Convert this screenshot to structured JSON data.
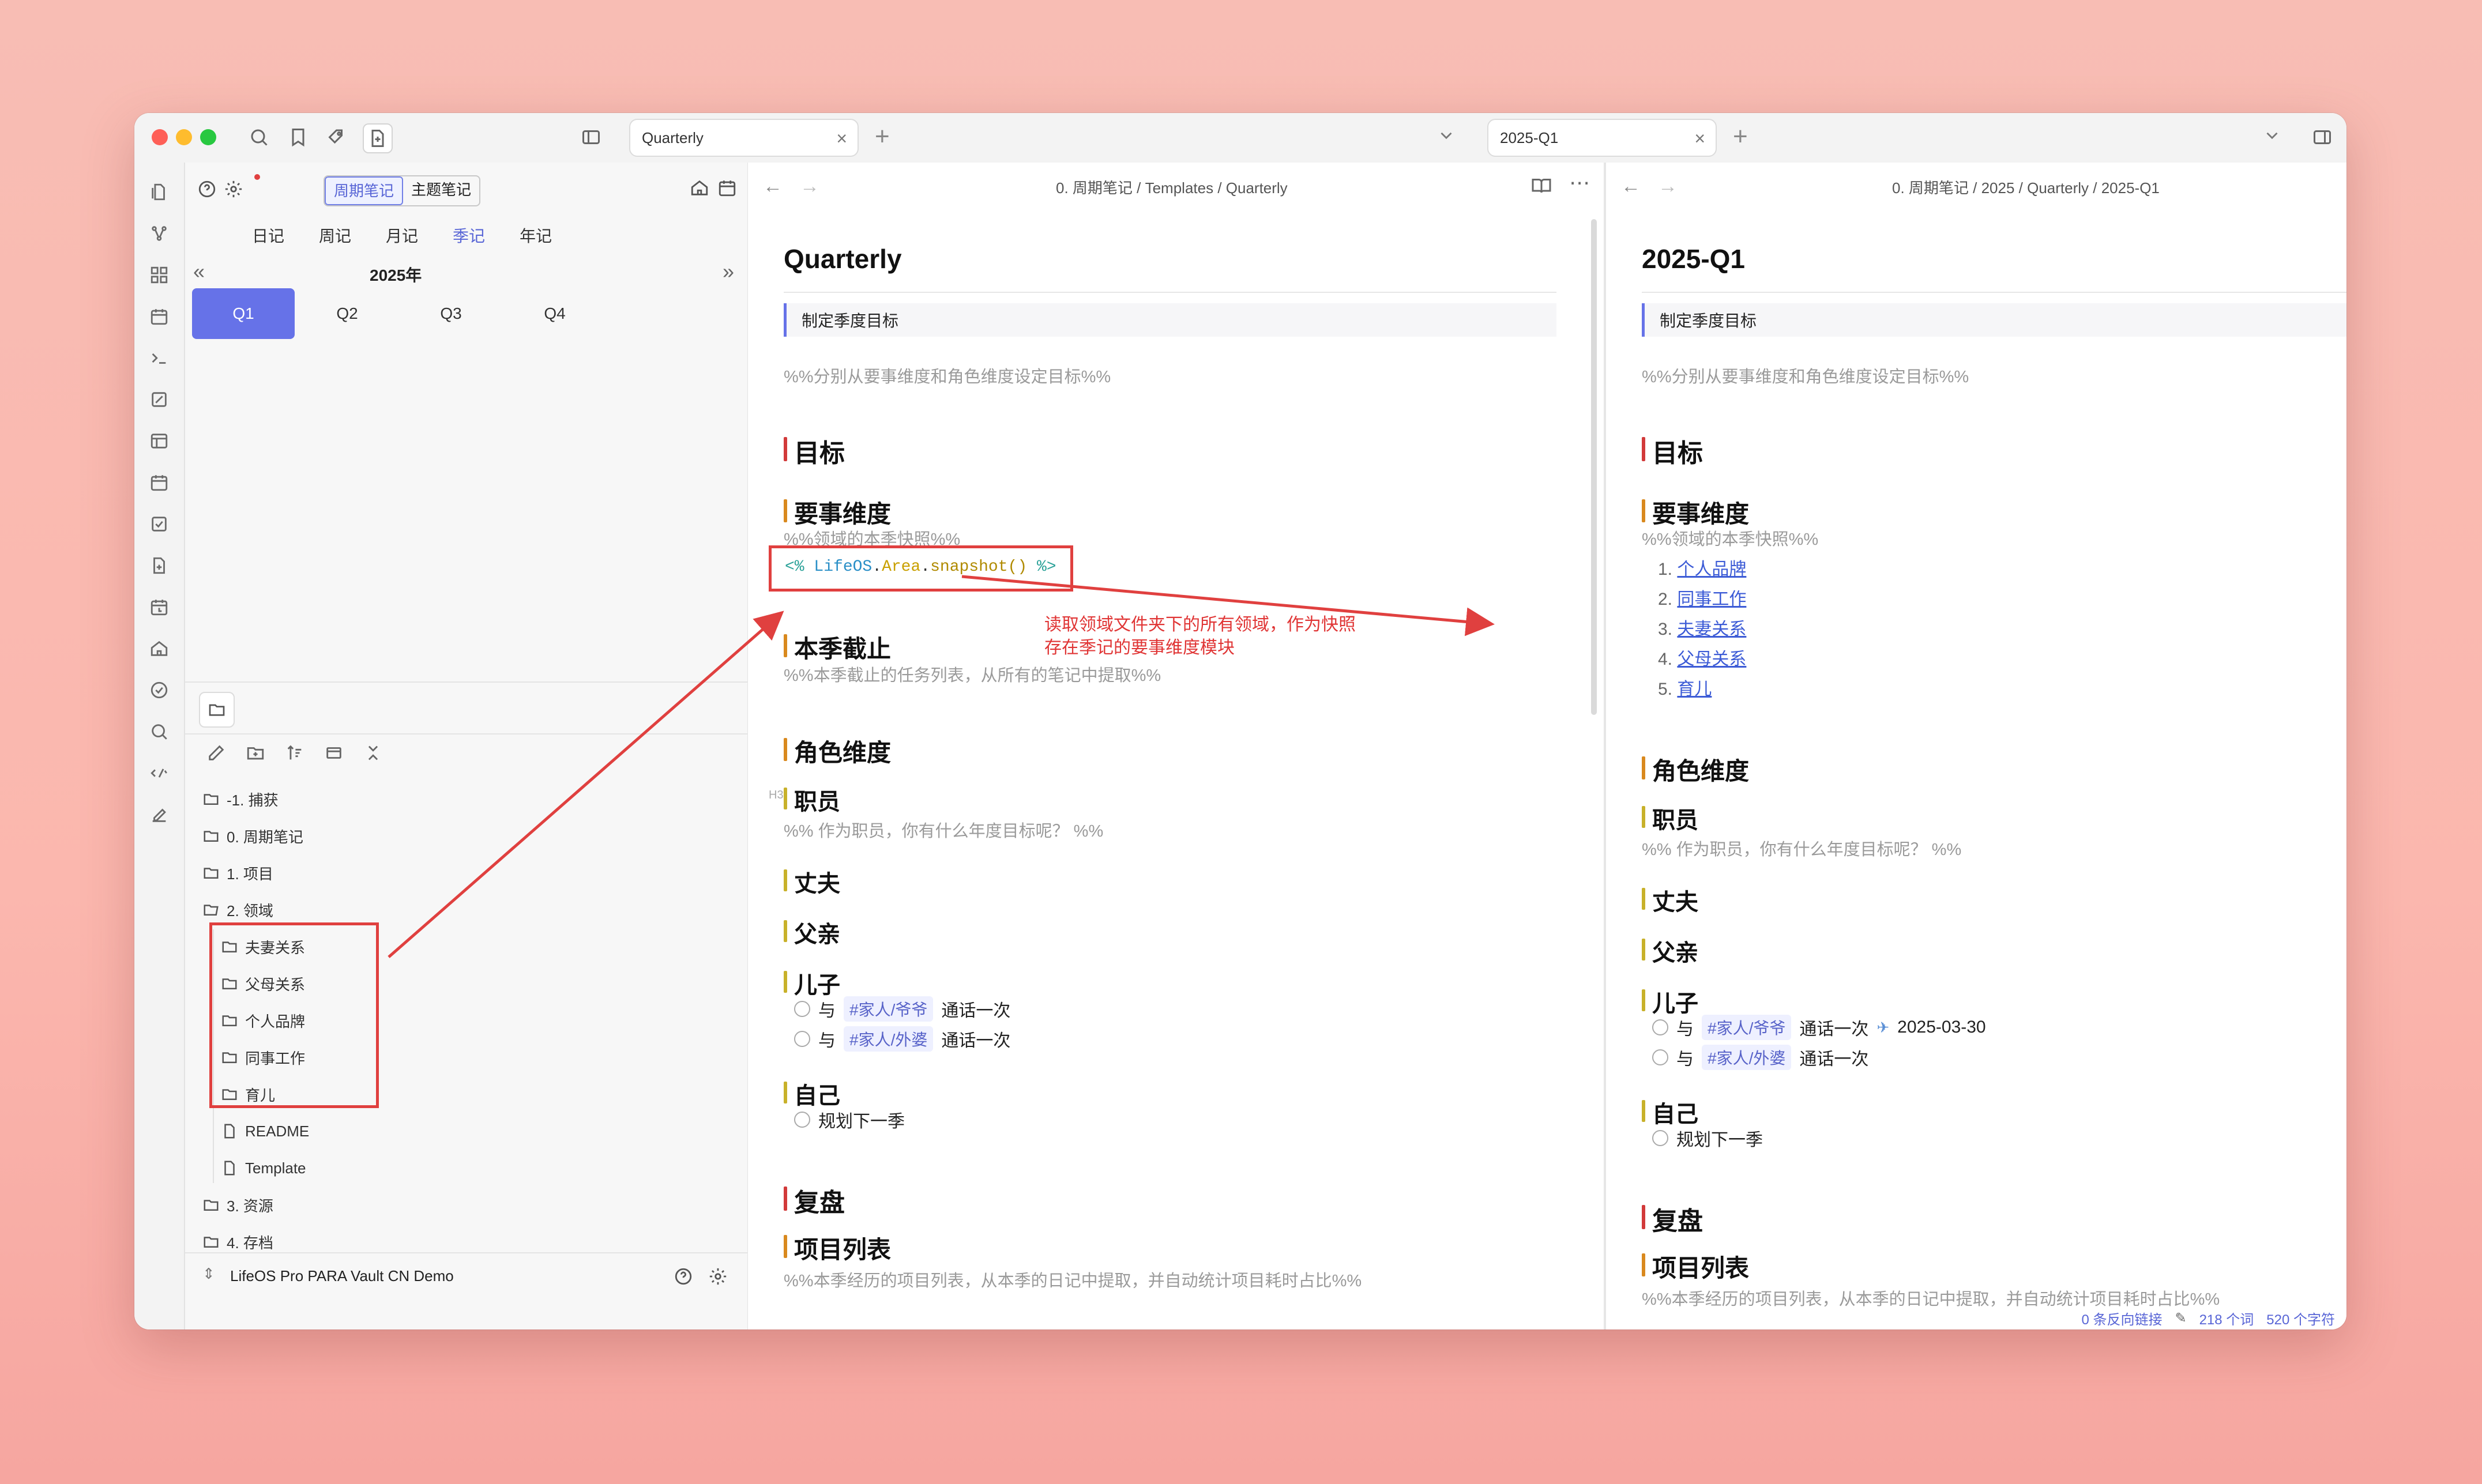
{
  "tabs": {
    "left": {
      "label": "Quarterly"
    },
    "right": {
      "label": "2025-Q1"
    }
  },
  "calendar": {
    "modes": [
      "周期笔记",
      "主题笔记"
    ],
    "periods": [
      "日记",
      "周记",
      "月记",
      "季记",
      "年记"
    ],
    "active_period": "季记",
    "year": "2025年",
    "quarters": [
      "Q1",
      "Q2",
      "Q3",
      "Q4"
    ],
    "active_quarter": "Q1"
  },
  "file_tree": [
    {
      "label": "-1. 捕获",
      "type": "folder",
      "depth": 0
    },
    {
      "label": "0. 周期笔记",
      "type": "folder",
      "depth": 0
    },
    {
      "label": "1. 项目",
      "type": "folder",
      "depth": 0
    },
    {
      "label": "2. 领域",
      "type": "folder-open",
      "depth": 0
    },
    {
      "label": "夫妻关系",
      "type": "folder",
      "depth": 1
    },
    {
      "label": "父母关系",
      "type": "folder",
      "depth": 1
    },
    {
      "label": "个人品牌",
      "type": "folder",
      "depth": 1
    },
    {
      "label": "同事工作",
      "type": "folder",
      "depth": 1
    },
    {
      "label": "育儿",
      "type": "folder",
      "depth": 1
    },
    {
      "label": "README",
      "type": "file",
      "depth": 1
    },
    {
      "label": "Template",
      "type": "file",
      "depth": 1
    },
    {
      "label": "3. 资源",
      "type": "folder",
      "depth": 0
    },
    {
      "label": "4. 存档",
      "type": "folder",
      "depth": 0
    }
  ],
  "vault": {
    "name": "LifeOS Pro PARA Vault CN Demo"
  },
  "left_pane": {
    "breadcrumb": [
      "0. 周期笔记",
      "Templates",
      "Quarterly"
    ],
    "title": "Quarterly",
    "callout": "制定季度目标",
    "intro_comment": "%%分别从要事维度和角色维度设定目标%%",
    "h_goal": "目标",
    "h_focus": "要事维度",
    "focus_comment": "%%领域的本季快照%%",
    "code": {
      "open": "<%",
      "obj": "LifeOS",
      "dot1": ".",
      "prop": "Area",
      "dot2": ".",
      "method": "snapshot()",
      "close": "%>"
    },
    "h_deadline": "本季截止",
    "deadline_comment": "%%本季截止的任务列表，从所有的笔记中提取%%",
    "h_roles": "角色维度",
    "h3_marker": "H3",
    "h_employee": "职员",
    "employee_comment": "%% 作为职员，你有什么年度目标呢？ %%",
    "h_husband": "丈夫",
    "h_father": "父亲",
    "h_son": "儿子",
    "son_tasks": [
      {
        "pre": "与",
        "tag": "#家人/爷爷",
        "post": "通话一次"
      },
      {
        "pre": "与",
        "tag": "#家人/外婆",
        "post": "通话一次"
      }
    ],
    "h_self": "自己",
    "self_task": "规划下一季",
    "h_review": "复盘",
    "h_projects": "项目列表",
    "projects_comment": "%%本季经历的项目列表，从本季的日记中提取，并自动统计项目耗时占比%%"
  },
  "right_pane": {
    "breadcrumb": [
      "0. 周期笔记",
      "2025",
      "Quarterly",
      "2025-Q1"
    ],
    "title": "2025-Q1",
    "callout": "制定季度目标",
    "intro_comment": "%%分别从要事维度和角色维度设定目标%%",
    "h_goal": "目标",
    "h_focus": "要事维度",
    "focus_comment": "%%领域的本季快照%%",
    "areas": [
      "个人品牌",
      "同事工作",
      "夫妻关系",
      "父母关系",
      "育儿"
    ],
    "h_roles": "角色维度",
    "h_employee": "职员",
    "employee_comment": "%% 作为职员，你有什么年度目标呢？ %%",
    "h_husband": "丈夫",
    "h_father": "父亲",
    "h_son": "儿子",
    "son_tasks": [
      {
        "pre": "与",
        "tag": "#家人/爷爷",
        "post": "通话一次",
        "date": "2025-03-30"
      },
      {
        "pre": "与",
        "tag": "#家人/外婆",
        "post": "通话一次"
      }
    ],
    "h_self": "自己",
    "self_task": "规划下一季",
    "h_review": "复盘",
    "h_projects": "项目列表",
    "projects_comment": "%%本季经历的项目列表，从本季的日记中提取，并自动统计项目耗时占比%%"
  },
  "annotation": {
    "line1": "读取领域文件夹下的所有领域，作为快照",
    "line2": "存在季记的要事维度模块"
  },
  "status": {
    "backlinks": "0 条反向链接",
    "words": "218 个词",
    "chars": "520 个字符"
  },
  "colors": {
    "accent": "#6672e8",
    "annotation_red": "#e0403f",
    "h1_bar": "#d23a3a",
    "h2_bar": "#d9891e",
    "h3_bar": "#c8b12a"
  }
}
